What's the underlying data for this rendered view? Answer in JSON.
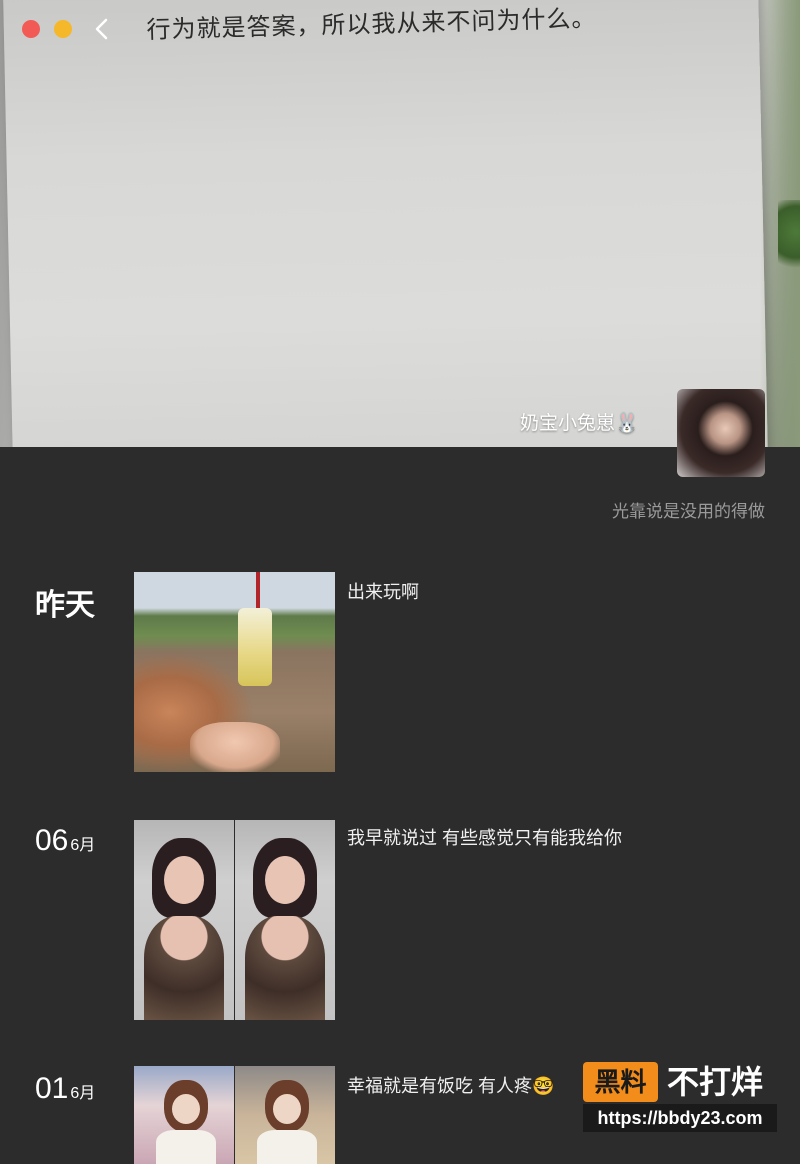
{
  "cover": {
    "quote": "行为就是答案，所以我从来不问为什么。"
  },
  "window": {
    "controls": [
      "close",
      "minimize"
    ],
    "back_icon": "chevron-left-icon"
  },
  "profile": {
    "username": "奶宝小兔崽🐰",
    "signature": "光靠说是没用的得做"
  },
  "moments": [
    {
      "date_label": "昨天",
      "text": "出来玩啊",
      "images": 1
    },
    {
      "date_day": "06",
      "date_month": "6月",
      "text": "我早就说过 有些感觉只有能我给你",
      "images": 2
    },
    {
      "date_day": "01",
      "date_month": "6月",
      "text": "幸福就是有饭吃 有人疼🤓",
      "images": 2
    }
  ],
  "watermark": {
    "badge": "黑料",
    "title": "不打烊",
    "url": "https://bbdy23.com"
  },
  "colors": {
    "background": "#2c2c2c",
    "close_dot": "#f25a55",
    "minimize_dot": "#f5b82a",
    "badge": "#f28c1a"
  }
}
